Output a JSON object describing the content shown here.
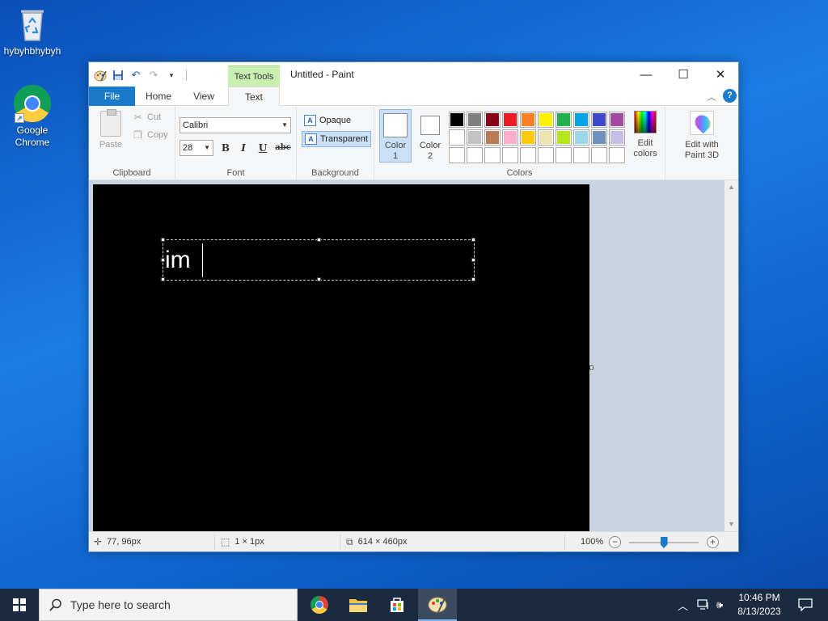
{
  "desktop": {
    "recycle_bin_label": "hybyhbhybyh",
    "chrome_label_line1": "Google",
    "chrome_label_line2": "Chrome"
  },
  "window": {
    "title": "Untitled - Paint",
    "context_tab": "Text Tools",
    "minimize": "—",
    "maximize": "☐",
    "close": "✕"
  },
  "tabs": {
    "file": "File",
    "home": "Home",
    "view": "View",
    "text": "Text"
  },
  "ribbon": {
    "clipboard": {
      "paste": "Paste",
      "cut": "Cut",
      "copy": "Copy",
      "label": "Clipboard"
    },
    "font": {
      "family": "Calibri",
      "size": "28",
      "bold": "B",
      "italic": "I",
      "underline": "U",
      "strikethrough": "abc",
      "label": "Font"
    },
    "background": {
      "opaque": "Opaque",
      "transparent": "Transparent",
      "label": "Background"
    },
    "colors": {
      "color1_line1": "Color",
      "color1_line2": "1",
      "color2_line1": "Color",
      "color2_line2": "2",
      "edit_line1": "Edit",
      "edit_line2": "colors",
      "label": "Colors",
      "palette": [
        "#000000",
        "#7f7f7f",
        "#880015",
        "#ed1c24",
        "#ff7f27",
        "#fff200",
        "#22b14c",
        "#00a2e8",
        "#3f48cc",
        "#a349a4",
        "#ffffff",
        "#c3c3c3",
        "#b97a57",
        "#ffaec9",
        "#ffc90e",
        "#efe4b0",
        "#b5e61d",
        "#99d9ea",
        "#7092be",
        "#c8bfe7",
        "#ffffff",
        "#ffffff",
        "#ffffff",
        "#ffffff",
        "#ffffff",
        "#ffffff",
        "#ffffff",
        "#ffffff",
        "#ffffff",
        "#ffffff"
      ]
    },
    "paint3d": {
      "line1": "Edit with",
      "line2": "Paint 3D"
    }
  },
  "canvas": {
    "typed_text": "im",
    "text_color": "#ffffff",
    "background": "#000000"
  },
  "status": {
    "cursor_pos": "77, 96px",
    "selection_size": "1 × 1px",
    "canvas_size": "614 × 460px",
    "zoom": "100%",
    "zoom_level_fraction": 0.5
  },
  "taskbar": {
    "search_placeholder": "Type here to search",
    "time": "10:46 PM",
    "date": "8/13/2023"
  }
}
